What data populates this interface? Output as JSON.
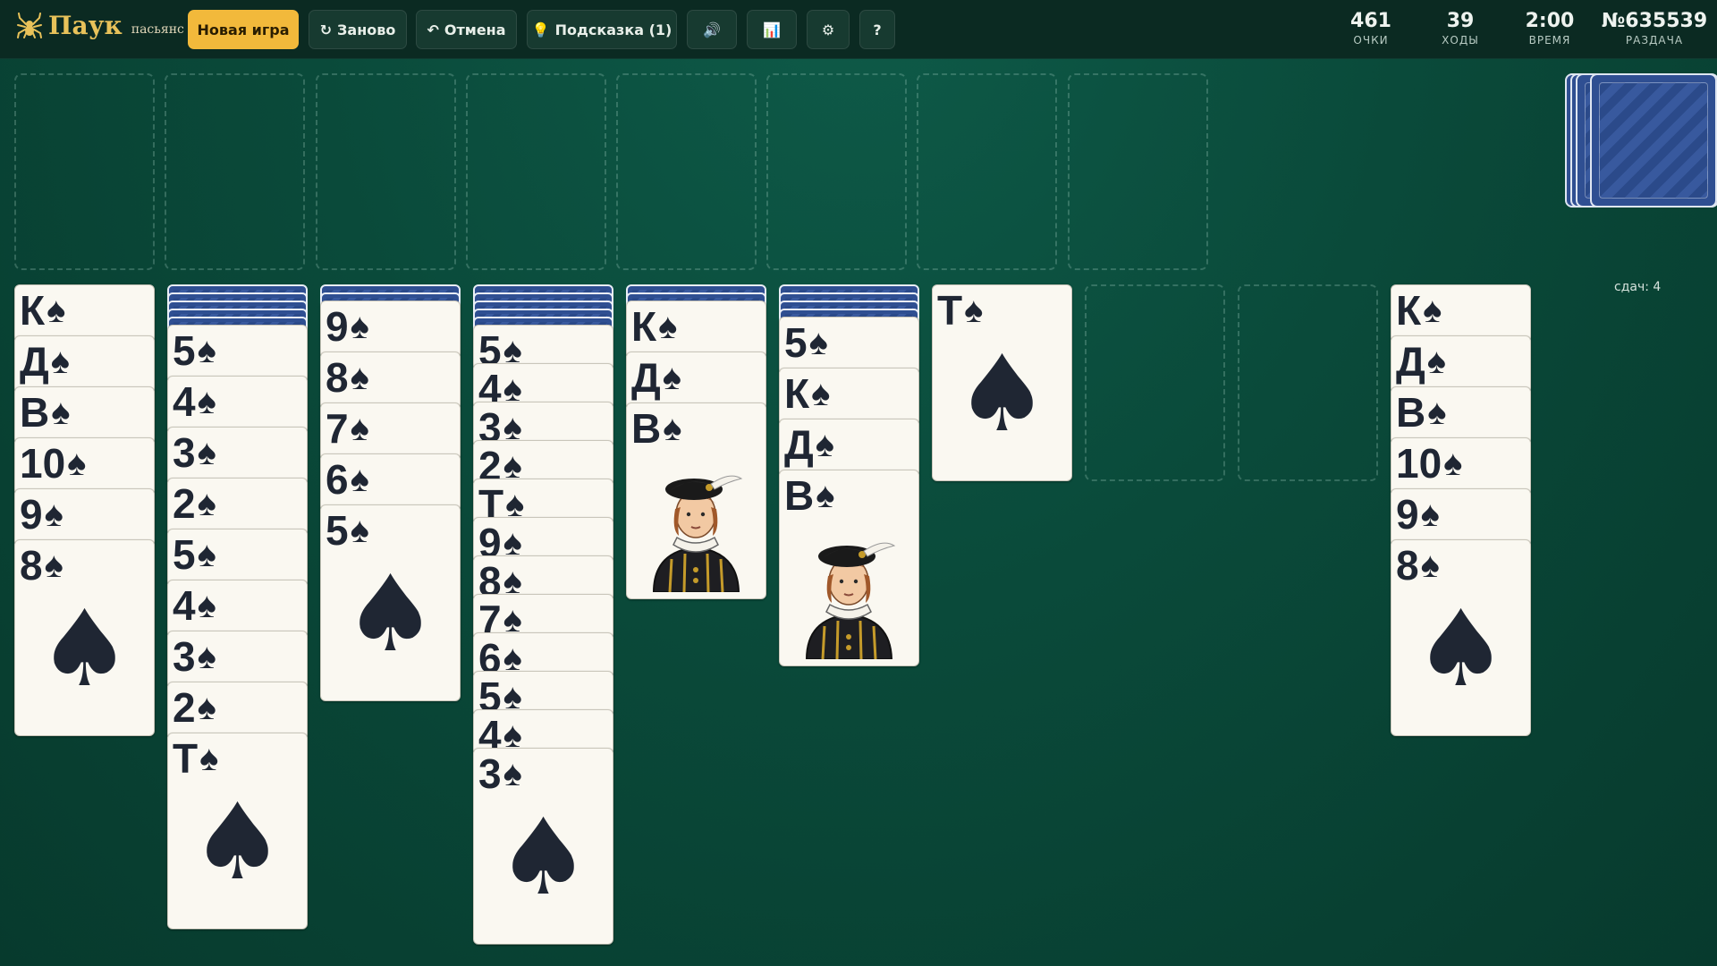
{
  "header": {
    "title": "Паук",
    "subtitle": "пасьянс",
    "buttons": {
      "new_game": "Новая игра",
      "restart": "Заново",
      "undo": "Отмена",
      "hint": "Подсказка (1)"
    },
    "icons": {
      "restart": "↻",
      "undo": "↶",
      "hint": "💡",
      "sound": "🔊",
      "stats": "📊",
      "settings": "⚙",
      "help": "?"
    },
    "stats": {
      "score_value": "461",
      "score_label": "ОЧКИ",
      "moves_value": "39",
      "moves_label": "ХОДЫ",
      "time_value": "2:00",
      "time_label": "ВРЕМЯ",
      "deal_value": "№635539",
      "deal_label": "РАЗДАЧА"
    }
  },
  "stock": {
    "deals_left": "сдач: 4"
  },
  "suit_symbol": "♠",
  "colors": {
    "accent": "#f2b93b",
    "table": "#0a4a3a",
    "card_back": "#2f4f92"
  },
  "tableau": [
    {
      "hidden": 0,
      "cards": [
        "К",
        "Д",
        "В",
        "10",
        "9",
        "8"
      ]
    },
    {
      "hidden": 5,
      "cards": [
        "5",
        "4",
        "3",
        "2",
        "5",
        "4",
        "3",
        "2",
        "Т"
      ]
    },
    {
      "hidden": 2,
      "cards": [
        "9",
        "8",
        "7",
        "6",
        "5"
      ]
    },
    {
      "hidden": 5,
      "cards": [
        "5",
        "4",
        "3",
        "2",
        "Т",
        "9",
        "8",
        "7",
        "6",
        "5",
        "4",
        "3"
      ]
    },
    {
      "hidden": 2,
      "cards": [
        "К",
        "Д",
        "В"
      ]
    },
    {
      "hidden": 4,
      "cards": [
        "5",
        "К",
        "Д",
        "В"
      ]
    },
    {
      "hidden": 0,
      "cards": [
        "Т"
      ]
    },
    {
      "hidden": 0,
      "cards": []
    },
    {
      "hidden": 0,
      "cards": []
    },
    {
      "hidden": 0,
      "cards": [
        "К",
        "Д",
        "В",
        "10",
        "9",
        "8"
      ]
    }
  ]
}
